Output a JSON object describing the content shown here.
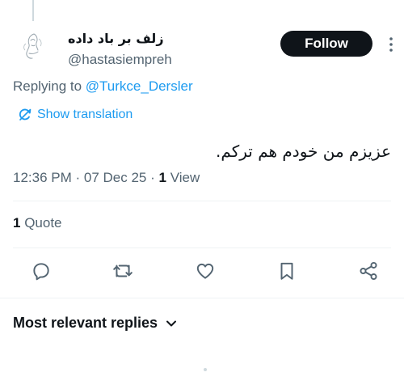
{
  "author": {
    "display_name": "زلف بر باد داده",
    "handle": "@hastasiempreh"
  },
  "follow_label": "Follow",
  "replying": {
    "prefix": "Replying to ",
    "mention": "@Turkce_Dersler"
  },
  "translation_label": "Show translation",
  "tweet_text": "عزیزم من خودم هم ترکم.",
  "meta": {
    "time": "12:36 PM",
    "date": "07 Dec 25",
    "views_count": "1",
    "views_label": "View"
  },
  "quotes": {
    "count": "1",
    "label": "Quote"
  },
  "replies_header": "Most relevant replies",
  "colors": {
    "accent": "#1d9bf0",
    "text": "#0f1419",
    "muted": "#536471"
  },
  "icons": [
    "reply-icon",
    "retweet-icon",
    "like-icon",
    "bookmark-icon",
    "share-icon",
    "more-icon",
    "translate-icon",
    "chevron-down-icon"
  ]
}
